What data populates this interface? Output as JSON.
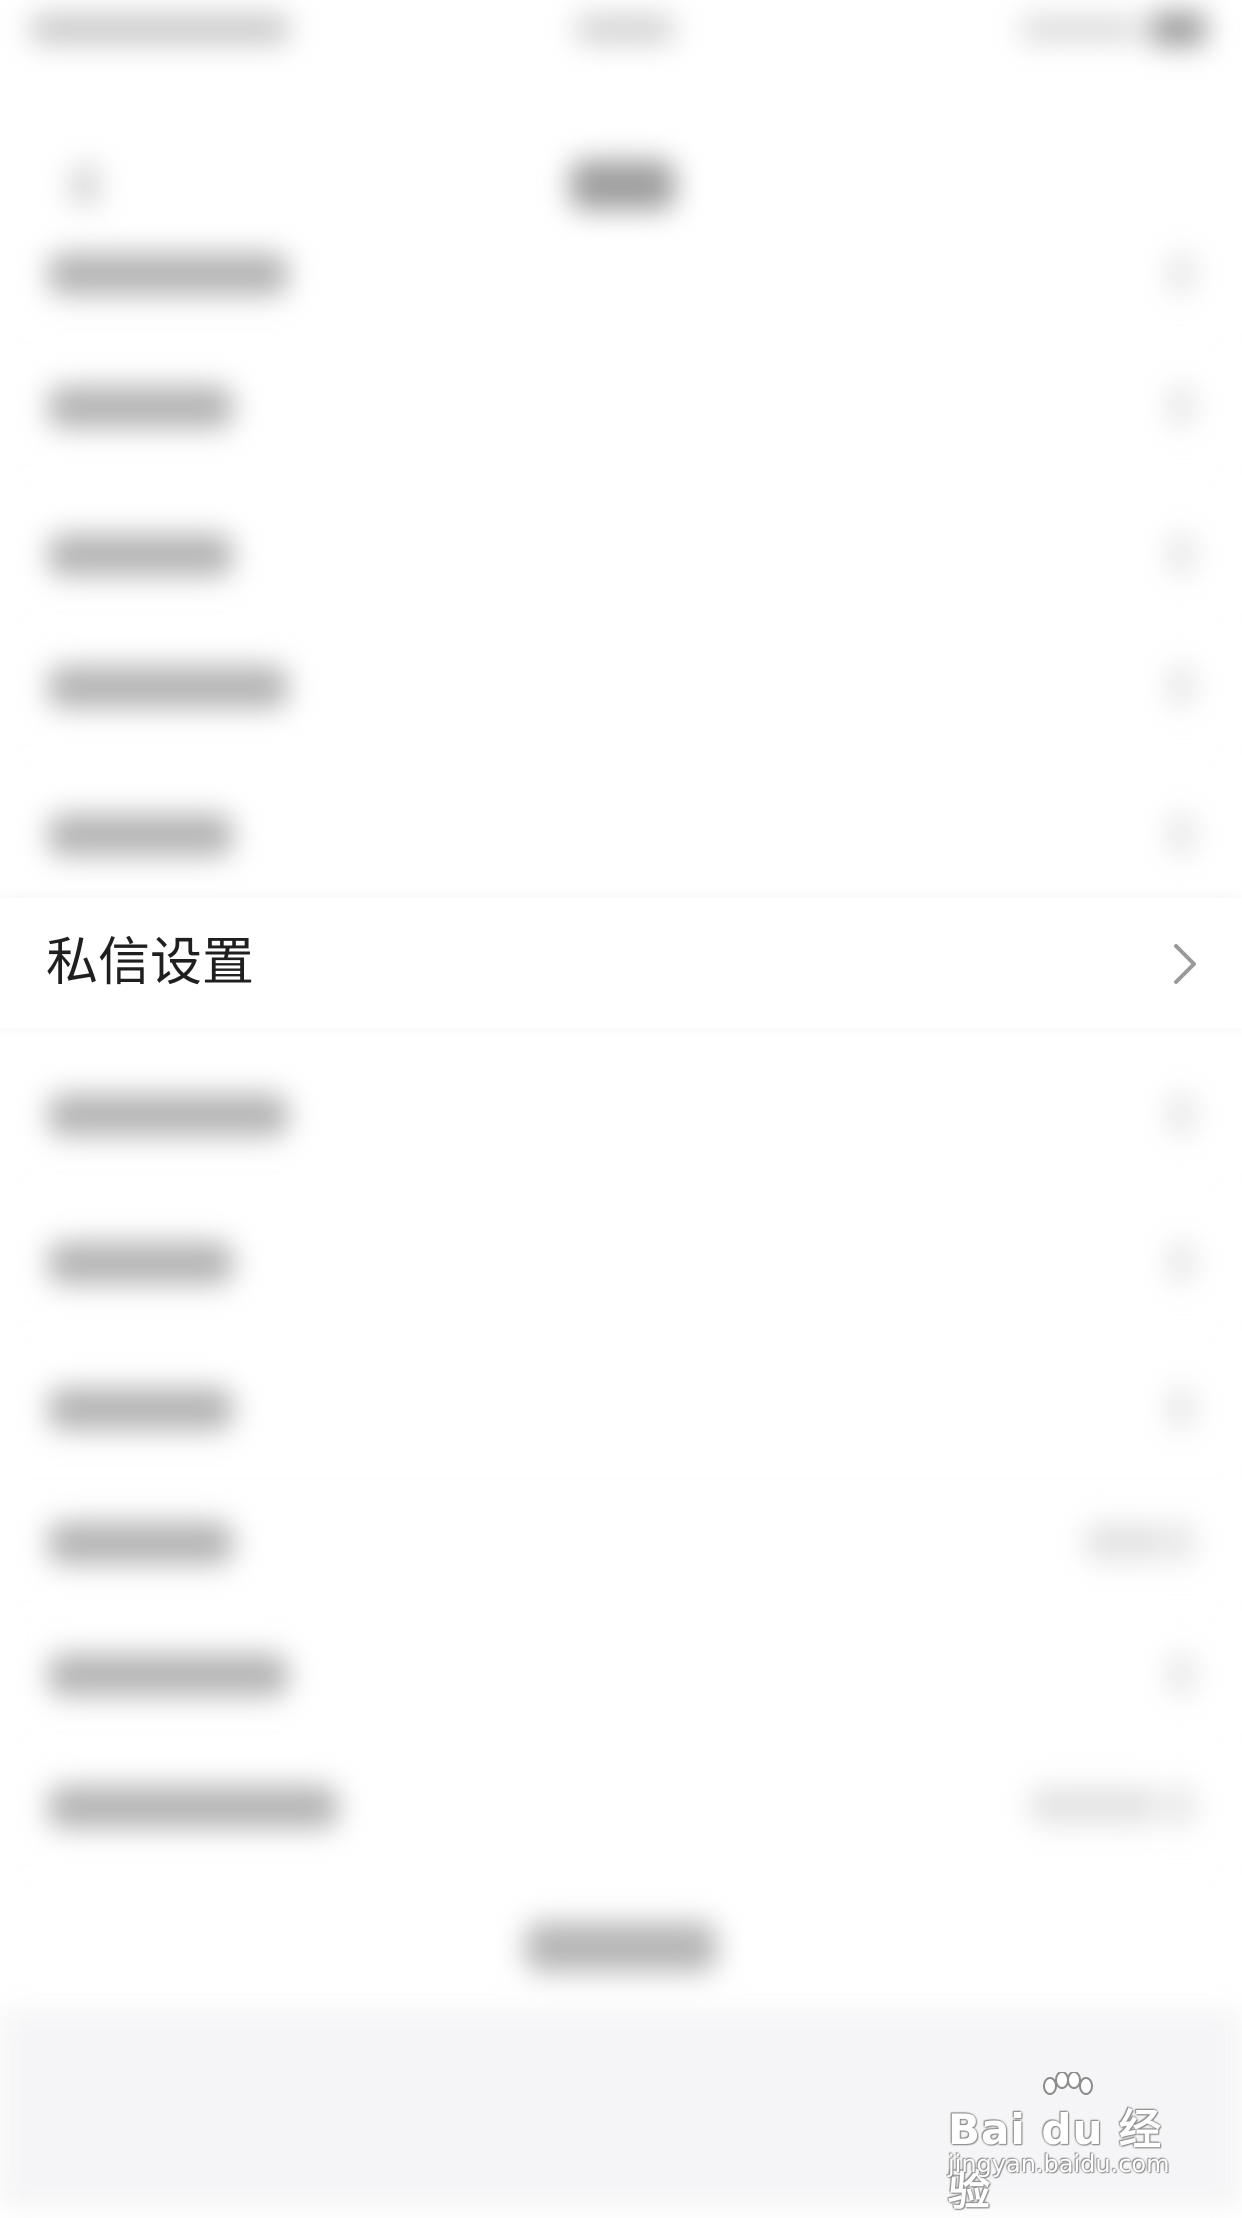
{
  "settings": {
    "focused_item": {
      "label": "私信设置"
    }
  },
  "watermark": {
    "brand": "Bai du 经验",
    "url": "jingyan.baidu.com"
  }
}
